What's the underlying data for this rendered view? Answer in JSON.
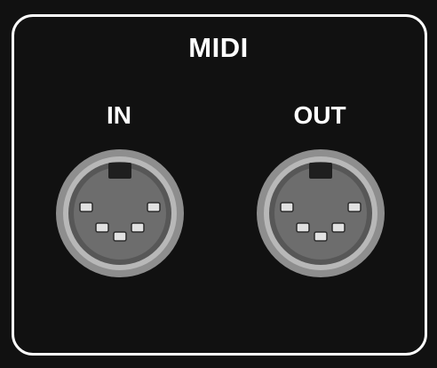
{
  "panel": {
    "title": "MIDI",
    "ports": [
      {
        "label": "IN"
      },
      {
        "label": "OUT"
      }
    ]
  },
  "colors": {
    "background": "#111111",
    "border": "#ffffff",
    "text": "#ffffff",
    "connector_ring": "#9a9a9a",
    "connector_face": "#6a6a6a",
    "pin": "#dcdcdc"
  },
  "icons": [
    "din-5-pin-connector-icon"
  ]
}
